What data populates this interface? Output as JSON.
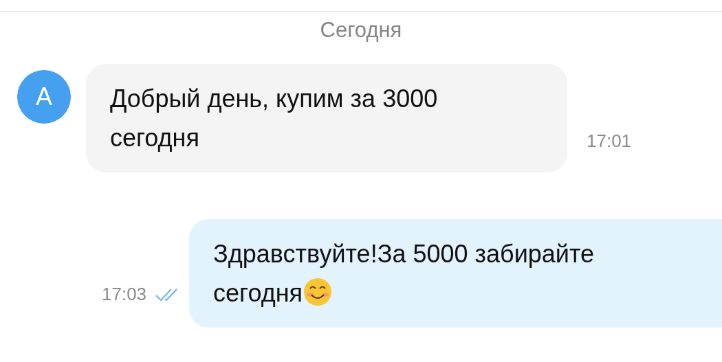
{
  "date_divider": "Сегодня",
  "messages": [
    {
      "kind": "incoming",
      "avatar": "А",
      "text": "Добрый день, купим за 3000 сегодня",
      "time": "17:01"
    },
    {
      "kind": "outgoing",
      "text": "Здравствуйте!За 5000 забирайте сегодня",
      "emoji": true,
      "time": "17:03",
      "read": true
    }
  ]
}
